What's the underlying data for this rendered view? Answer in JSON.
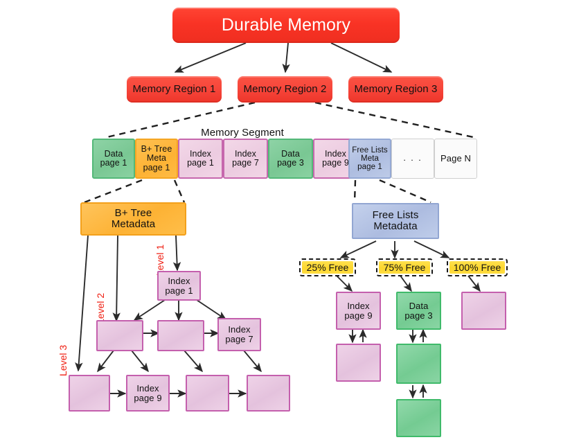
{
  "diagram": {
    "title": "Durable Memory",
    "regions": [
      {
        "label": "Memory Region 1"
      },
      {
        "label": "Memory Region 2"
      },
      {
        "label": "Memory Region 3"
      }
    ],
    "segment": {
      "caption": "Memory Segment",
      "cells": [
        {
          "label": "Data\npage 1",
          "kind": "green"
        },
        {
          "label": "B+ Tree\nMeta\npage 1",
          "kind": "orange"
        },
        {
          "label": "Index\npage 1",
          "kind": "pink"
        },
        {
          "label": "Index\npage 7",
          "kind": "pink"
        },
        {
          "label": "Data\npage 3",
          "kind": "green"
        },
        {
          "label": "Index\npage 9",
          "kind": "pink"
        },
        {
          "label": "Free Lists\nMeta\npage 1",
          "kind": "blue"
        },
        {
          "label": ". . .",
          "kind": "gray"
        },
        {
          "label": "Page N",
          "kind": "gray"
        }
      ]
    },
    "btree": {
      "meta_label": "B+ Tree\nMetadata",
      "level_labels": [
        "Level 1",
        "Level 2",
        "Level 3"
      ],
      "level1": [
        {
          "label": "Index\npage 1"
        }
      ],
      "level2": [
        {
          "label": ""
        },
        {
          "label": ""
        },
        {
          "label": "Index\npage 7"
        }
      ],
      "level3": [
        {
          "label": ""
        },
        {
          "label": "Index\npage 9"
        },
        {
          "label": ""
        },
        {
          "label": ""
        }
      ]
    },
    "freelists": {
      "meta_label": "Free Lists\nMetadata",
      "buckets": [
        {
          "tag": "25% Free",
          "chain": [
            {
              "label": "Index\npage 9",
              "kind": "pink"
            },
            {
              "label": "",
              "kind": "pink"
            }
          ]
        },
        {
          "tag": "75% Free",
          "chain": [
            {
              "label": "Data\npage 3",
              "kind": "green"
            },
            {
              "label": "",
              "kind": "green"
            },
            {
              "label": "",
              "kind": "green"
            }
          ]
        },
        {
          "tag": "100% Free",
          "chain": [
            {
              "label": "",
              "kind": "pink"
            }
          ]
        }
      ]
    },
    "colors": {
      "red": "#f6453a",
      "green": "#79c793",
      "orange": "#fdb234",
      "pink": "#e4c2dd",
      "blue": "#aebde0",
      "yellow": "#fcd62f",
      "level_label_red": "#ef1d10",
      "arrow": "#2b2b2b"
    }
  }
}
